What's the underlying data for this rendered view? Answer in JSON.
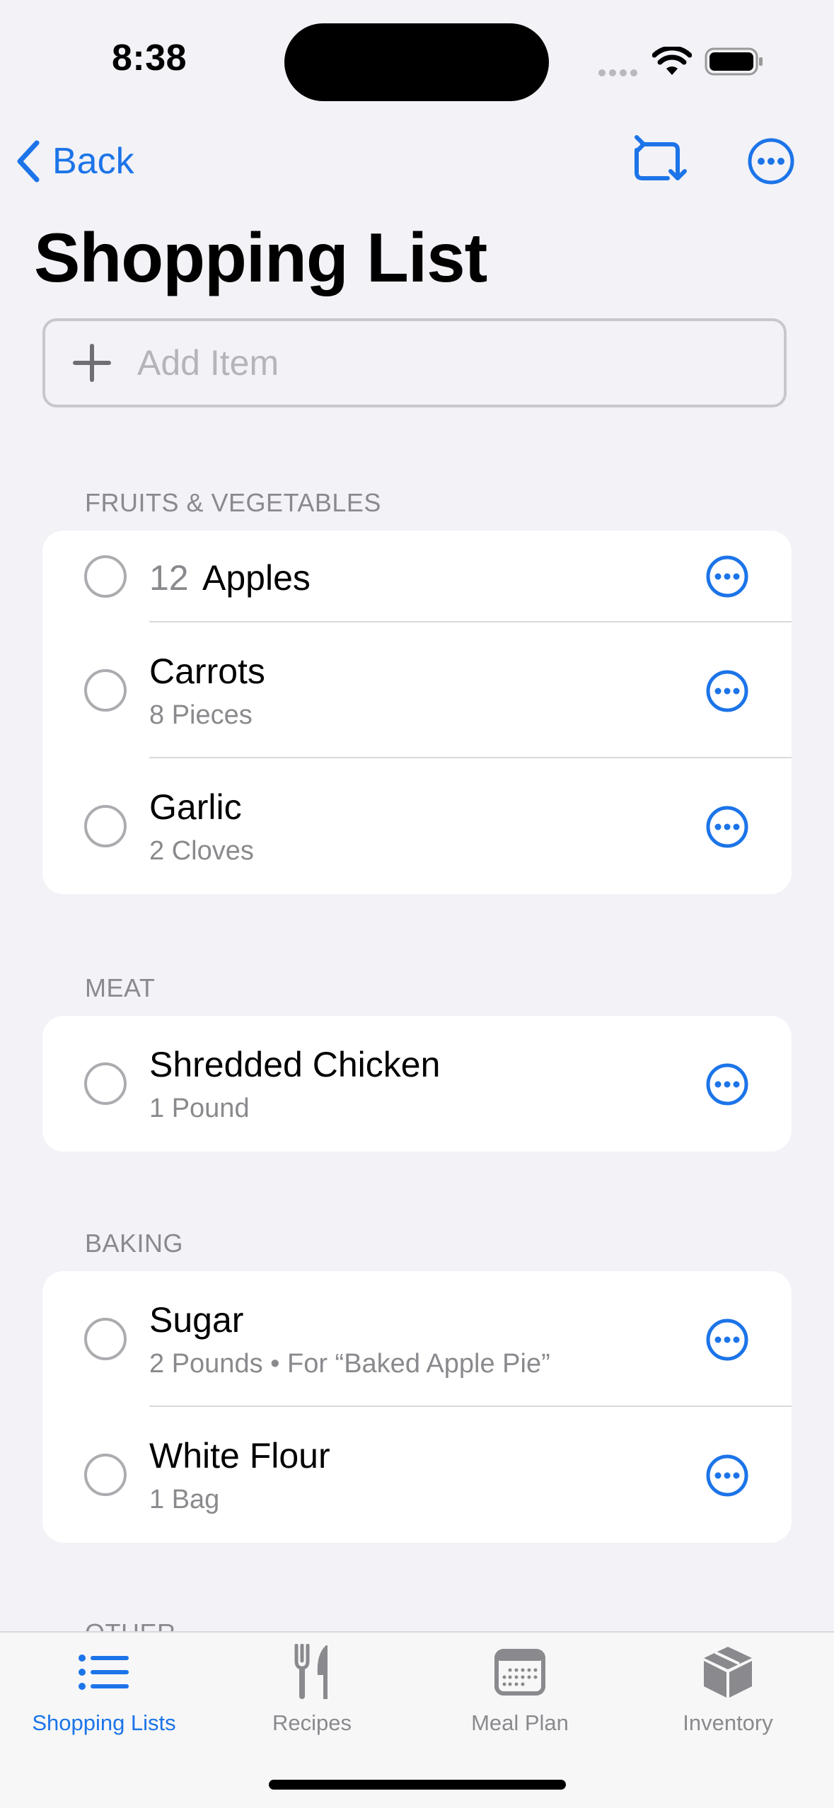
{
  "status_bar": {
    "time": "8:38"
  },
  "nav": {
    "back_label": "Back"
  },
  "page": {
    "title": "Shopping List"
  },
  "add_item": {
    "placeholder": "Add Item",
    "value": ""
  },
  "sections": [
    {
      "header": "FRUITS & VEGETABLES",
      "items": [
        {
          "quantity": "12",
          "name": "Apples",
          "detail": ""
        },
        {
          "name": "Carrots",
          "detail": "8 Pieces"
        },
        {
          "name": "Garlic",
          "detail": "2 Cloves"
        }
      ]
    },
    {
      "header": "MEAT",
      "items": [
        {
          "name": "Shredded Chicken",
          "detail": "1 Pound"
        }
      ]
    },
    {
      "header": "BAKING",
      "items": [
        {
          "name": "Sugar",
          "detail": "2 Pounds • For “Baked Apple Pie”"
        },
        {
          "name": "White Flour",
          "detail": "1 Bag"
        }
      ]
    },
    {
      "header": "OTHER"
    }
  ],
  "tabs": [
    {
      "label": "Shopping Lists",
      "icon": "list-icon",
      "active": true
    },
    {
      "label": "Recipes",
      "icon": "fork-knife-icon",
      "active": false
    },
    {
      "label": "Meal Plan",
      "icon": "calendar-icon",
      "active": false
    },
    {
      "label": "Inventory",
      "icon": "box-icon",
      "active": false
    }
  ],
  "colors": {
    "accent": "#1c74e8",
    "background": "#f2f2f7",
    "secondary_text": "#8a8a8e"
  }
}
